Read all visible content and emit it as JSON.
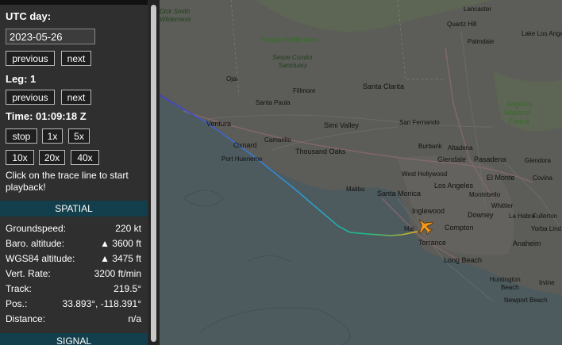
{
  "sidebar": {
    "utc_day_label": "UTC day:",
    "utc_day_value": "2023-05-26",
    "day_prev": "previous",
    "day_next": "next",
    "leg_label": "Leg: 1",
    "leg_prev": "previous",
    "leg_next": "next",
    "time_label": "Time: 01:09:18 Z",
    "playback": {
      "stop": "stop",
      "x1": "1x",
      "x5": "5x",
      "x10": "10x",
      "x20": "20x",
      "x40": "40x"
    },
    "hint": "Click on the trace line to start playback!",
    "spatial_header": "SPATIAL",
    "spatial": [
      {
        "key": "Groundspeed:",
        "value": "220 kt"
      },
      {
        "key": "Baro. altitude:",
        "value": "▲ 3600 ft"
      },
      {
        "key": "WGS84 altitude:",
        "value": "▲ 3475 ft"
      },
      {
        "key": "Vert. Rate:",
        "value": "3200 ft/min"
      },
      {
        "key": "Track:",
        "value": "219.5°"
      },
      {
        "key": "Pos.:",
        "value": "33.893°, -118.391°"
      },
      {
        "key": "Distance:",
        "value": "n/a"
      }
    ],
    "signal_header": "SIGNAL"
  },
  "map": {
    "places": {
      "lancaster": "Lancaster",
      "quartz_hill": "Quartz Hill",
      "palmdale": "Palmdale",
      "lake_los_angeles": "Lake Los Ange",
      "sespe_wilderness": "Sespe Wilderness",
      "sespe_condor": "Sespe Condor",
      "sanctuary": "Sanctuary",
      "dick_smith": "Dick Smith",
      "wilderness": "Wilderness",
      "ojai": "Ojai",
      "fillmore": "Fillmore",
      "santa_clarita": "Santa Clarita",
      "angeles": "Angeles",
      "national": "National",
      "forest": "Forest",
      "santa_paula": "Santa Paula",
      "ventura": "Ventura",
      "simi_valley": "Simi Valley",
      "san_fernando": "San Fernando",
      "oxnard": "Oxnard",
      "camarillo": "Camarillo",
      "thousand_oaks": "Thousand Oaks",
      "port_hueneme": "Port Hueneme",
      "burbank": "Burbank",
      "pasadena": "Pasadena",
      "altadena": "Altadena",
      "glendale": "Glendale",
      "west_hollywood": "West Hollywood",
      "los_angeles": "Los Angeles",
      "el_monte": "El Monte",
      "glendora": "Glendora",
      "covina": "Covina",
      "malibu": "Malibu",
      "santa_monica": "Santa Monica",
      "inglewood": "Inglewood",
      "montebello": "Montebello",
      "whittier": "Whittier",
      "la_habra": "La Habra",
      "downey": "Downey",
      "compton": "Compton",
      "fullerton": "Fullerton",
      "yorba_linda": "Yorba Lind",
      "anaheim": "Anaheim",
      "torrance": "Torrance",
      "long_beach": "Long Beach",
      "huntington_beach": "Huntington",
      "beach": "Beach",
      "irvine": "Irvine",
      "newport_beach": "Newport Beach",
      "manhattan": "Mai"
    }
  }
}
